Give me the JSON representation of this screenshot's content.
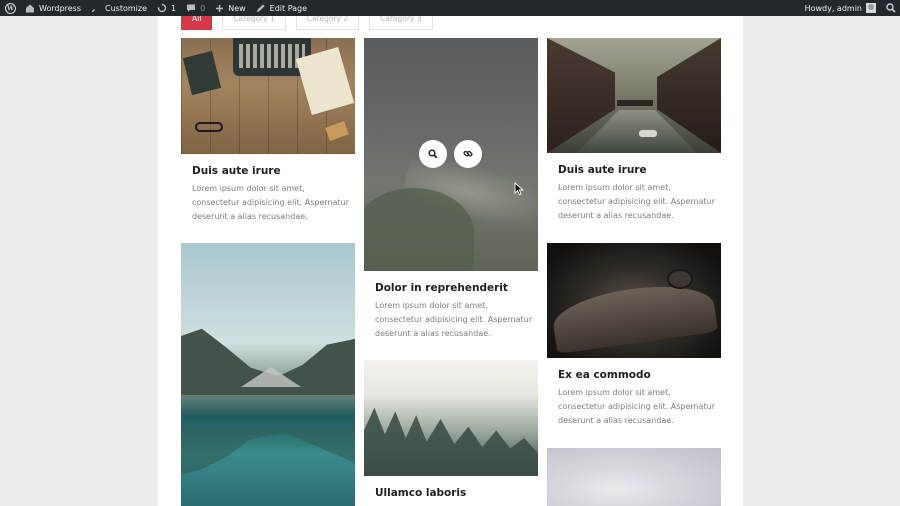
{
  "admin_bar": {
    "site_name": "Wordpress",
    "customize": "Customize",
    "updates_count": "1",
    "comments_count": "0",
    "new_label": "New",
    "edit_page": "Edit Page",
    "howdy": "Howdy, admin"
  },
  "filters": [
    {
      "label": "All",
      "active": true
    },
    {
      "label": "Category 1",
      "active": false
    },
    {
      "label": "Category 2",
      "active": false
    },
    {
      "label": "Category 3",
      "active": false
    }
  ],
  "cards": [
    {
      "title": "Duis aute irure",
      "desc": "Lorem ipsum dolor sit amet, consectetur adipisicing elit. Aspernatur deserunt a alias recusandae.",
      "image": "typewriter-desk"
    },
    {
      "title": "Dolor in reprehenderit",
      "desc": "Lorem ipsum dolor sit amet, consectetur adipisicing elit. Aspernatur deserunt a alias recusandae.",
      "image": "misty-coast"
    },
    {
      "title": "Duis aute irure",
      "desc": "Lorem ipsum dolor sit amet, consectetur adipisicing elit. Aspernatur deserunt a alias recusandae.",
      "image": "canal-city"
    },
    {
      "title": "",
      "desc": "",
      "image": "mountain-lake"
    },
    {
      "title": "Ex ea commodo",
      "desc": "Lorem ipsum dolor sit amet, consectetur adipisicing elit. Aspernatur deserunt a alias recusandae.",
      "image": "vintage-car"
    },
    {
      "title": "Ullamco laboris",
      "desc": "",
      "image": "misty-forest"
    },
    {
      "title": "",
      "desc": "",
      "image": "cloudy-sky"
    }
  ],
  "overlay_icons": [
    "search-icon",
    "link-icon"
  ]
}
